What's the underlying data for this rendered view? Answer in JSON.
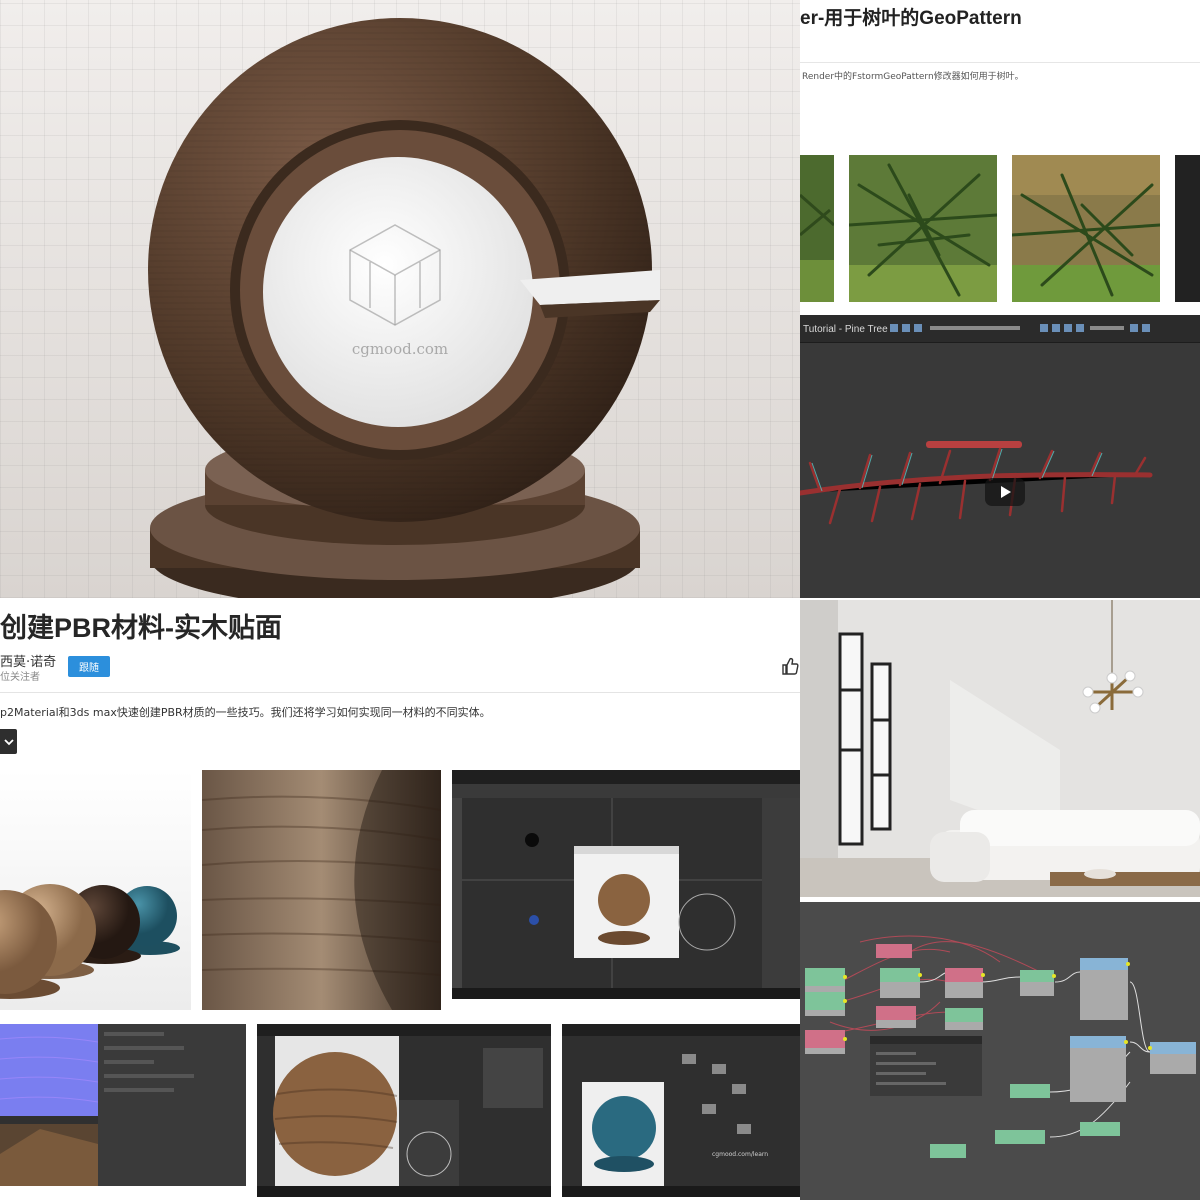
{
  "top_right": {
    "title": "er-用于树叶的GeoPattern",
    "description": "Render中的FstormGeoPattern修改器如何用于树叶。"
  },
  "video": {
    "title": "Tutorial - Pine Tree"
  },
  "hero": {
    "watermark": "cgmood.com"
  },
  "article": {
    "title": "创建PBR材料-实木贴面",
    "author": "西莫·诺奇",
    "followers": "位关注者",
    "follow_label": "跟随",
    "description": "p2Material和3ds max快速创建PBR材质的一些技巧。我们还将学习如何实现同一材料的不同实体。"
  },
  "colors": {
    "accent_blue": "#2c8fdc",
    "wood_dark": "#5a4030",
    "node_green": "#7ec49a",
    "node_blue": "#88b4d6",
    "node_red": "#d07088"
  },
  "icons": [
    "like-icon",
    "chevron-down-icon",
    "play-icon"
  ]
}
